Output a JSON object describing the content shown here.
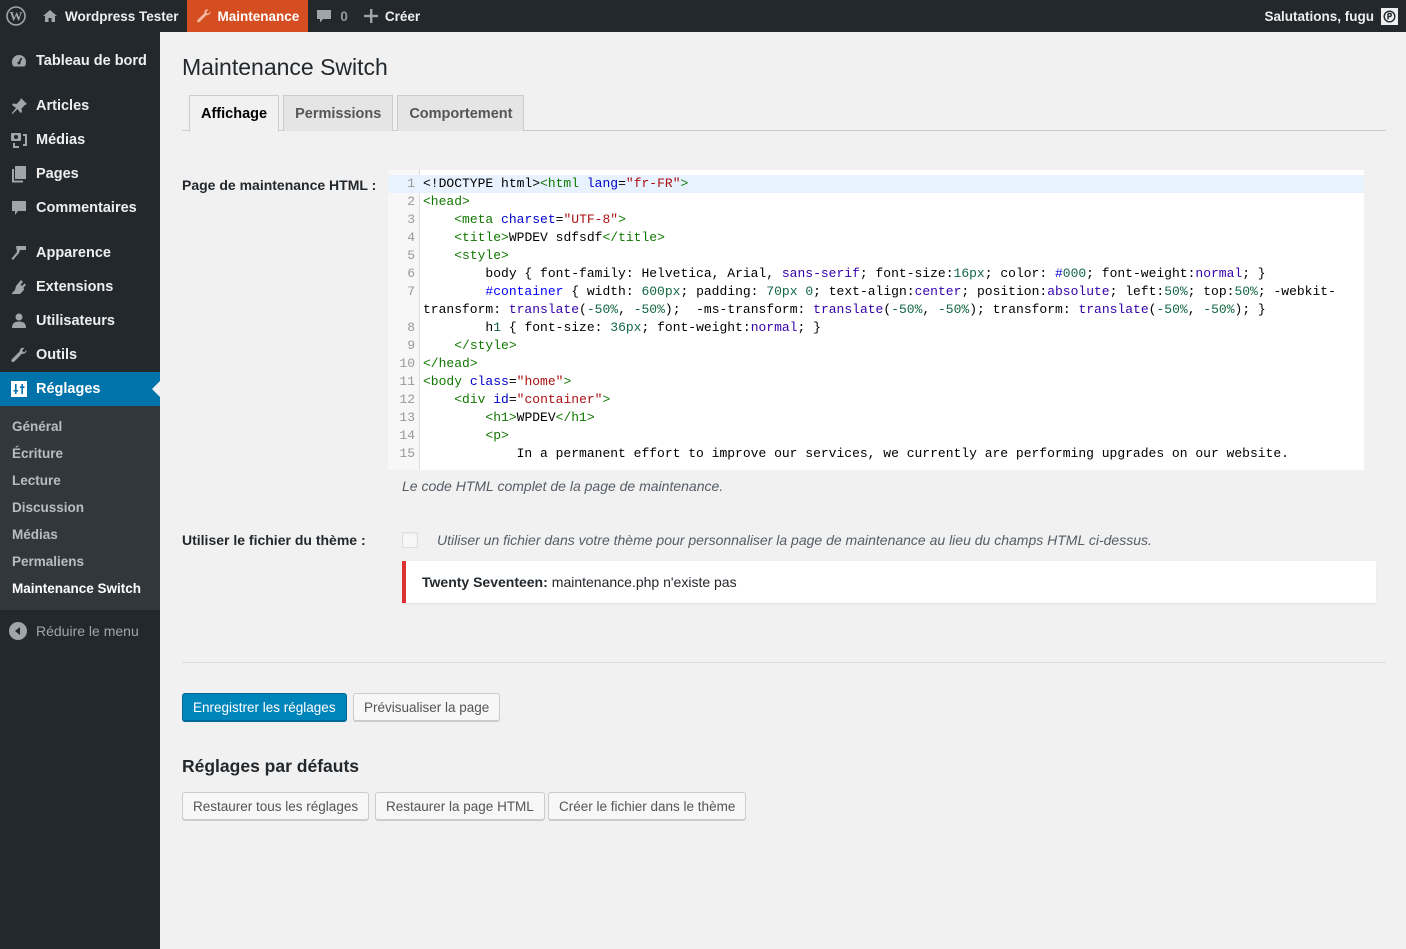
{
  "adminbar": {
    "site_name": "Wordpress Tester",
    "maintenance_label": "Maintenance",
    "comments_count": "0",
    "new_label": "Créer",
    "greeting": "Salutations, fugu",
    "maintenance_color": "#d54e21"
  },
  "sidebar": {
    "items": [
      {
        "label": "Tableau de bord",
        "icon": "dashboard-icon"
      },
      {
        "label": "Articles",
        "icon": "pin-icon"
      },
      {
        "label": "Médias",
        "icon": "media-icon"
      },
      {
        "label": "Pages",
        "icon": "pages-icon"
      },
      {
        "label": "Commentaires",
        "icon": "comment-icon"
      },
      {
        "label": "Apparence",
        "icon": "brush-icon"
      },
      {
        "label": "Extensions",
        "icon": "plugin-icon"
      },
      {
        "label": "Utilisateurs",
        "icon": "user-icon"
      },
      {
        "label": "Outils",
        "icon": "wrench-icon"
      },
      {
        "label": "Réglages",
        "icon": "settings-icon",
        "active": true
      }
    ],
    "submenu": [
      "Général",
      "Écriture",
      "Lecture",
      "Discussion",
      "Médias",
      "Permaliens",
      "Maintenance Switch"
    ],
    "submenu_current": "Maintenance Switch",
    "collapse_label": "Réduire le menu",
    "active_color": "#0073aa"
  },
  "page": {
    "title": "Maintenance Switch",
    "tabs": [
      {
        "label": "Affichage",
        "active": true
      },
      {
        "label": "Permissions",
        "active": false
      },
      {
        "label": "Comportement",
        "active": false
      }
    ]
  },
  "form": {
    "html_label": "Page de maintenance HTML :",
    "html_description": "Le code HTML complet de la page de maintenance.",
    "code_lines": [
      {
        "n": "1",
        "text": "<!DOCTYPE html><html lang=\"fr-FR\">"
      },
      {
        "n": "2",
        "text": "<head>"
      },
      {
        "n": "3",
        "text": "    <meta charset=\"UTF-8\">"
      },
      {
        "n": "4",
        "text": "    <title>WPDEV sdfsdf</title>"
      },
      {
        "n": "5",
        "text": "    <style>"
      },
      {
        "n": "6",
        "text": "        body { font-family: Helvetica, Arial, sans-serif; font-size:16px; color: #000; font-weight:normal; }"
      },
      {
        "n": "7",
        "text": "        #container { width: 600px; padding: 70px 0; text-align:center; position:absolute; left:50%; top:50%; -webkit-transform: translate(-50%, -50%);  -ms-transform: translate(-50%, -50%); transform: translate(-50%, -50%); }"
      },
      {
        "n": "8",
        "text": "        h1 { font-size: 36px; font-weight:normal; }"
      },
      {
        "n": "9",
        "text": "    </style>"
      },
      {
        "n": "10",
        "text": "</head>"
      },
      {
        "n": "11",
        "text": "<body class=\"home\">"
      },
      {
        "n": "12",
        "text": "    <div id=\"container\">"
      },
      {
        "n": "13",
        "text": "        <h1>WPDEV</h1>"
      },
      {
        "n": "14",
        "text": "        <p>"
      },
      {
        "n": "15",
        "text": "            In a permanent effort to improve our services, we currently are performing upgrades on our website."
      }
    ],
    "theme_file_label": "Utiliser le fichier du thème :",
    "theme_file_checked": false,
    "theme_file_description": "Utiliser un fichier dans votre thème pour personnaliser la page de maintenance au lieu du champs HTML ci-dessus.",
    "notice_theme": "Twenty Seventeen:",
    "notice_message": "maintenance.php n'existe pas",
    "notice_color": "#dc3232"
  },
  "actions": {
    "save_label": "Enregistrer les réglages",
    "preview_label": "Prévisualiser la page"
  },
  "defaults": {
    "title": "Réglages par défauts",
    "restore_all_label": "Restaurer tous les réglages",
    "restore_html_label": "Restaurer la page HTML",
    "create_file_label": "Créer le fichier dans le thème"
  }
}
